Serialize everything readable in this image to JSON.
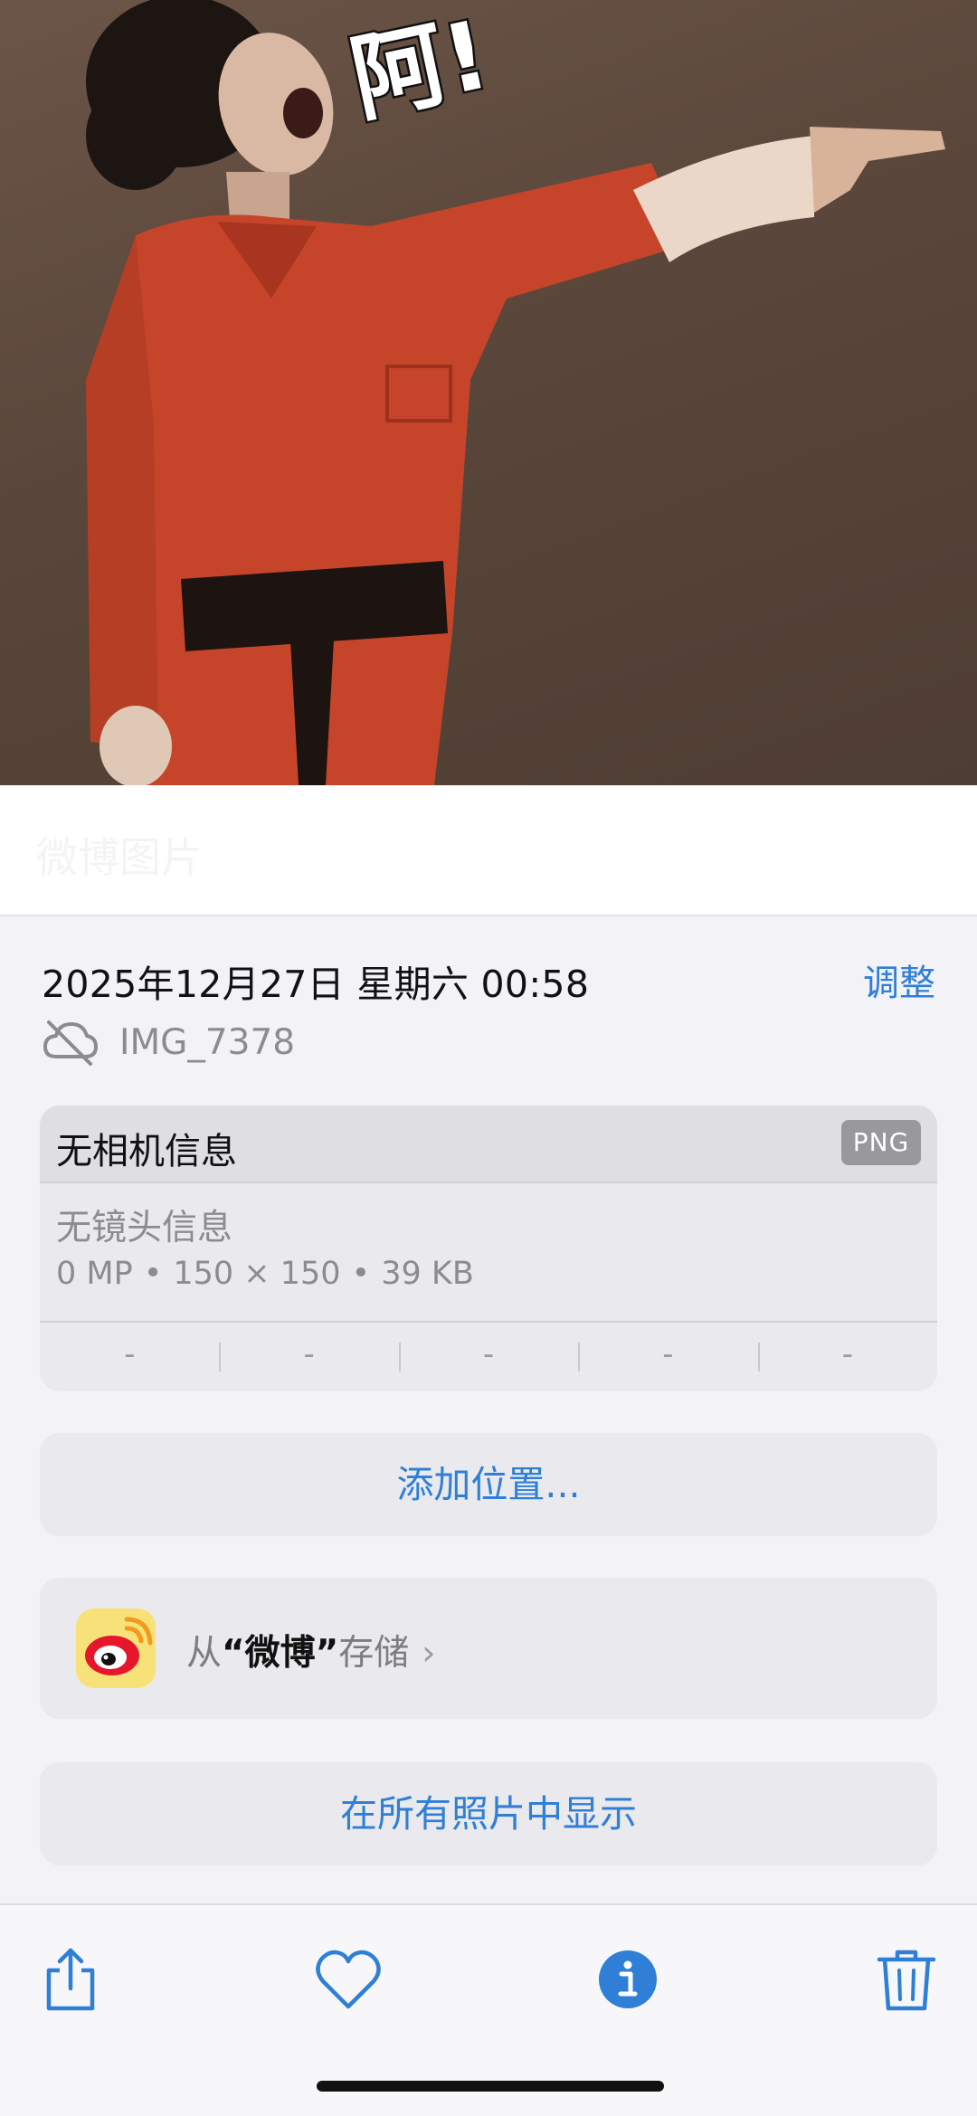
{
  "photo": {
    "overlay_text": "阿!",
    "caption_ghost": "微博图片"
  },
  "info": {
    "datetime": "2025年12月27日 星期六 00:58",
    "adjust_label": "调整",
    "file_name": "IMG_7378"
  },
  "camera": {
    "title": "无相机信息",
    "format_badge": "PNG",
    "lens": "无镜头信息",
    "megapixels": "0 MP",
    "dimensions": "150 × 150",
    "file_size": "39 KB",
    "separator": "•",
    "exif": [
      "-",
      "-",
      "-",
      "-",
      "-"
    ]
  },
  "actions": {
    "add_location": "添加位置...",
    "saved_prefix": "从",
    "saved_app": "“微博”",
    "saved_suffix": "存储",
    "show_all": "在所有照片中显示"
  },
  "toolbar": {
    "icons": [
      "share-icon",
      "heart-icon",
      "info-icon",
      "trash-icon"
    ]
  },
  "colors": {
    "accent": "#2f7fd6",
    "background": "#f2f2f7",
    "secondary_text": "#8b8b90"
  }
}
